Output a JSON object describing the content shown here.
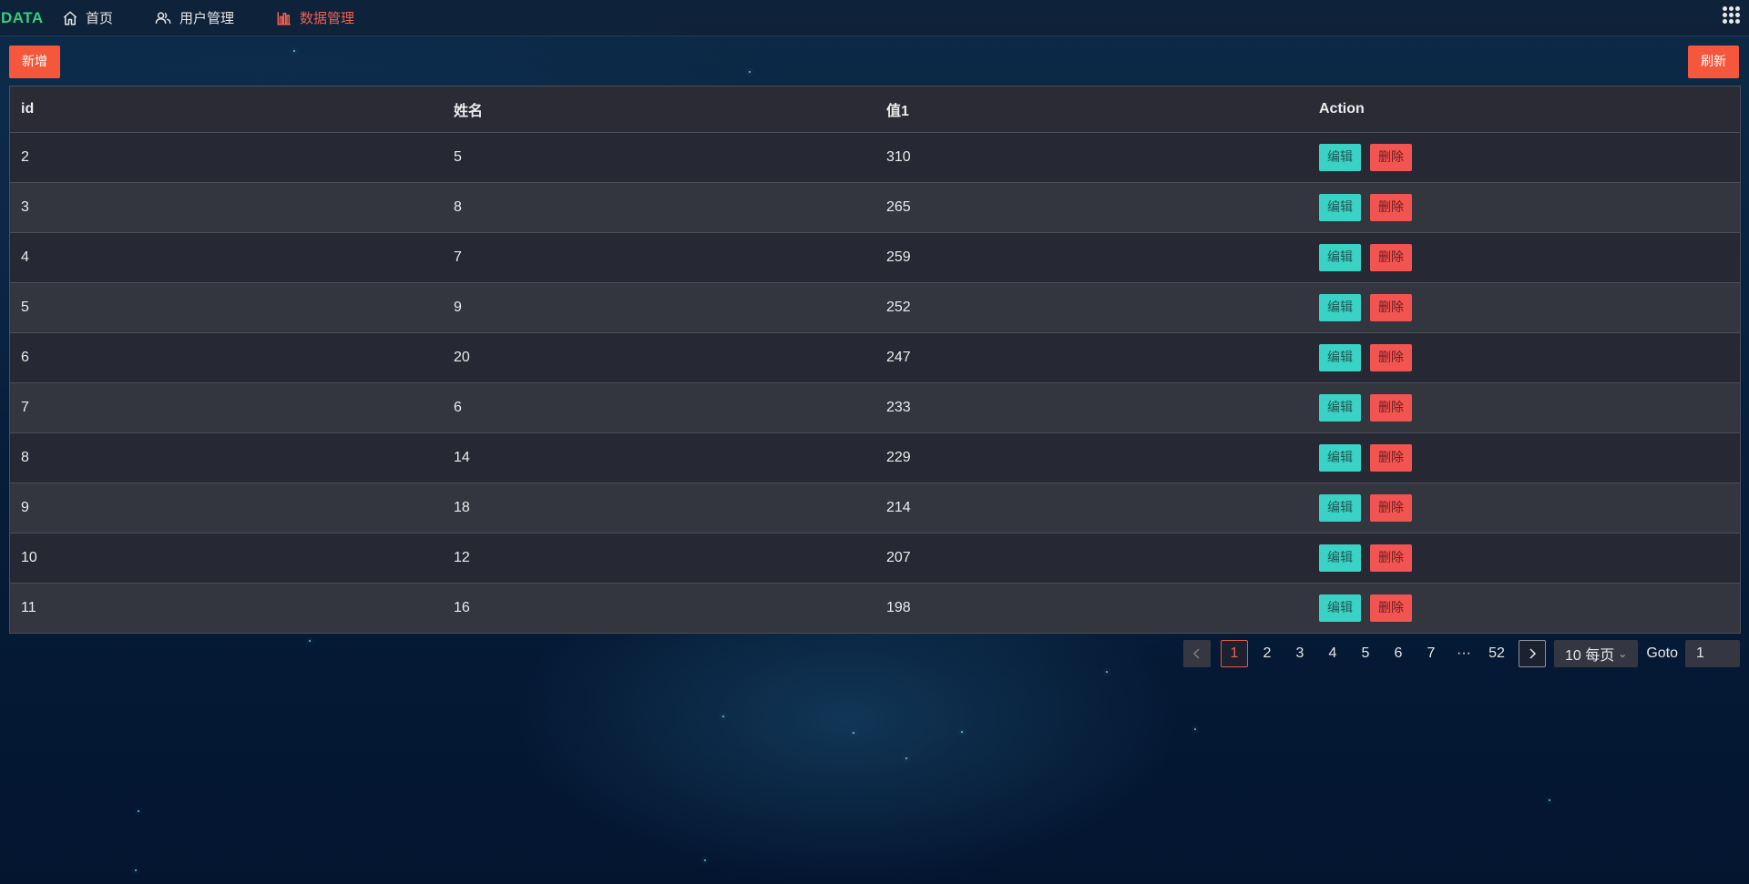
{
  "brand": "DATA",
  "nav": {
    "home": "首页",
    "users": "用户管理",
    "data": "数据管理"
  },
  "toolbar": {
    "add_label": "新增",
    "refresh_label": "刷新"
  },
  "table": {
    "columns": [
      "id",
      "姓名",
      "值1",
      "Action"
    ],
    "rows": [
      {
        "id": "2",
        "name": "5",
        "value": "310"
      },
      {
        "id": "3",
        "name": "8",
        "value": "265"
      },
      {
        "id": "4",
        "name": "7",
        "value": "259"
      },
      {
        "id": "5",
        "name": "9",
        "value": "252"
      },
      {
        "id": "6",
        "name": "20",
        "value": "247"
      },
      {
        "id": "7",
        "name": "6",
        "value": "233"
      },
      {
        "id": "8",
        "name": "14",
        "value": "229"
      },
      {
        "id": "9",
        "name": "18",
        "value": "214"
      },
      {
        "id": "10",
        "name": "12",
        "value": "207"
      },
      {
        "id": "11",
        "name": "16",
        "value": "198"
      }
    ],
    "edit_label": "编辑",
    "delete_label": "删除"
  },
  "pagination": {
    "pages": [
      "1",
      "2",
      "3",
      "4",
      "5",
      "6",
      "7",
      "···",
      "52"
    ],
    "current": "1",
    "page_size": "10 每页",
    "goto_label": "Goto",
    "goto_value": "1"
  },
  "colors": {
    "accent": "#f4573c",
    "brand": "#30d07f",
    "edit": "#3ad2c5",
    "delete": "#f15451"
  }
}
